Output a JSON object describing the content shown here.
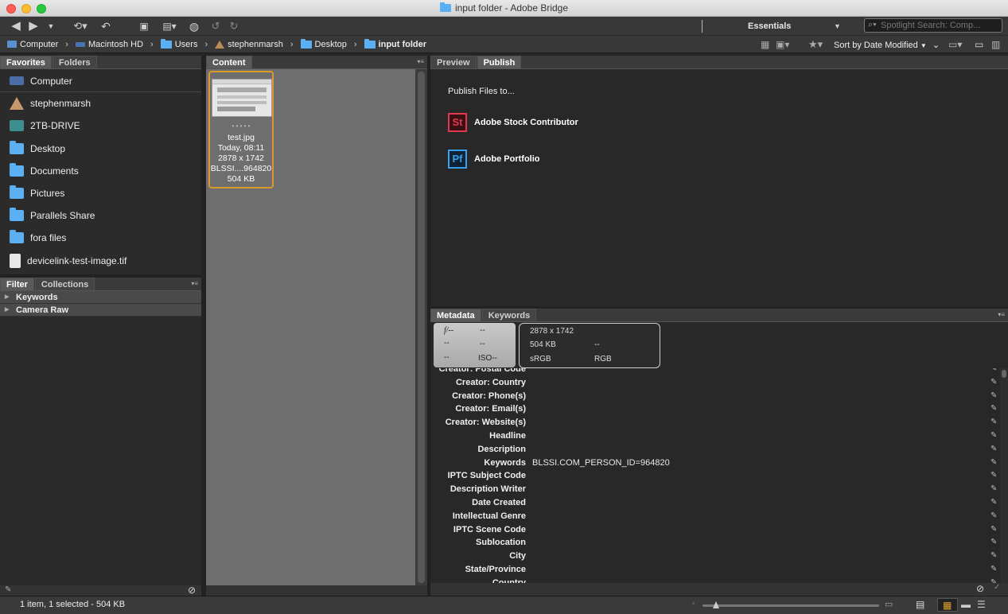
{
  "window": {
    "title": "input folder - Adobe Bridge"
  },
  "toolbar": {
    "workspace": "Essentials",
    "search_placeholder": "Spotlight Search: Comp..."
  },
  "path": [
    {
      "label": "Computer",
      "icon": "computer-icon"
    },
    {
      "label": "Macintosh HD",
      "icon": "drive-icon"
    },
    {
      "label": "Users",
      "icon": "folder-icon"
    },
    {
      "label": "stephenmarsh",
      "icon": "home-icon"
    },
    {
      "label": "Desktop",
      "icon": "folder-icon"
    },
    {
      "label": "input folder",
      "icon": "folder-icon"
    }
  ],
  "sort_label": "Sort by Date Modified",
  "left_tabs": {
    "favorites": "Favorites",
    "folders": "Folders"
  },
  "favorites": [
    {
      "label": "Computer",
      "icon": "computer"
    },
    {
      "label": "stephenmarsh",
      "icon": "home"
    },
    {
      "label": "2TB-DRIVE",
      "icon": "drive"
    },
    {
      "label": "Desktop",
      "icon": "folder"
    },
    {
      "label": "Documents",
      "icon": "folder"
    },
    {
      "label": "Pictures",
      "icon": "folder"
    },
    {
      "label": "Parallels Share",
      "icon": "folder"
    },
    {
      "label": "fora files",
      "icon": "folder"
    },
    {
      "label": "devicelink-test-image.tif",
      "icon": "file"
    }
  ],
  "filter_tabs": {
    "filter": "Filter",
    "collections": "Collections"
  },
  "filters": [
    "Keywords",
    "Camera Raw"
  ],
  "content": {
    "tab": "Content",
    "item": {
      "stars": "• • • • •",
      "name": "test.jpg",
      "date": "Today, 08:11",
      "dims": "2878 x 1742",
      "id": "BLSSI....964820",
      "size": "504 KB"
    }
  },
  "preview_tabs": {
    "preview": "Preview",
    "publish": "Publish"
  },
  "publish": {
    "heading": "Publish Files to...",
    "targets": [
      {
        "label": "Adobe Stock Contributor",
        "badge": "St",
        "color": "#e0384f"
      },
      {
        "label": "Adobe Portfolio",
        "badge": "Pf",
        "color": "#3aa0e8"
      }
    ]
  },
  "meta_tabs": {
    "metadata": "Metadata",
    "keywords": "Keywords"
  },
  "camera_box": {
    "aperture": "f/--",
    "r1": "--",
    "r2a": "--",
    "r2b": "--",
    "r3a": "--",
    "iso": "ISO--"
  },
  "file_box": {
    "dims": "2878 x 1742",
    "size": "504 KB",
    "size_extra": "--",
    "profile": "sRGB",
    "mode": "RGB"
  },
  "metadata_rows": [
    {
      "label": "Creator: Postal Code",
      "value": ""
    },
    {
      "label": "Creator: Country",
      "value": ""
    },
    {
      "label": "Creator: Phone(s)",
      "value": ""
    },
    {
      "label": "Creator: Email(s)",
      "value": ""
    },
    {
      "label": "Creator: Website(s)",
      "value": ""
    },
    {
      "label": "Headline",
      "value": ""
    },
    {
      "label": "Description",
      "value": ""
    },
    {
      "label": "Keywords",
      "value": "BLSSI.COM_PERSON_ID=964820"
    },
    {
      "label": "IPTC Subject Code",
      "value": ""
    },
    {
      "label": "Description Writer",
      "value": ""
    },
    {
      "label": "Date Created",
      "value": ""
    },
    {
      "label": "Intellectual Genre",
      "value": ""
    },
    {
      "label": "IPTC Scene Code",
      "value": ""
    },
    {
      "label": "Sublocation",
      "value": ""
    },
    {
      "label": "City",
      "value": ""
    },
    {
      "label": "State/Province",
      "value": ""
    },
    {
      "label": "Country",
      "value": ""
    }
  ],
  "status": {
    "text": "1 item, 1 selected - 504 KB"
  }
}
